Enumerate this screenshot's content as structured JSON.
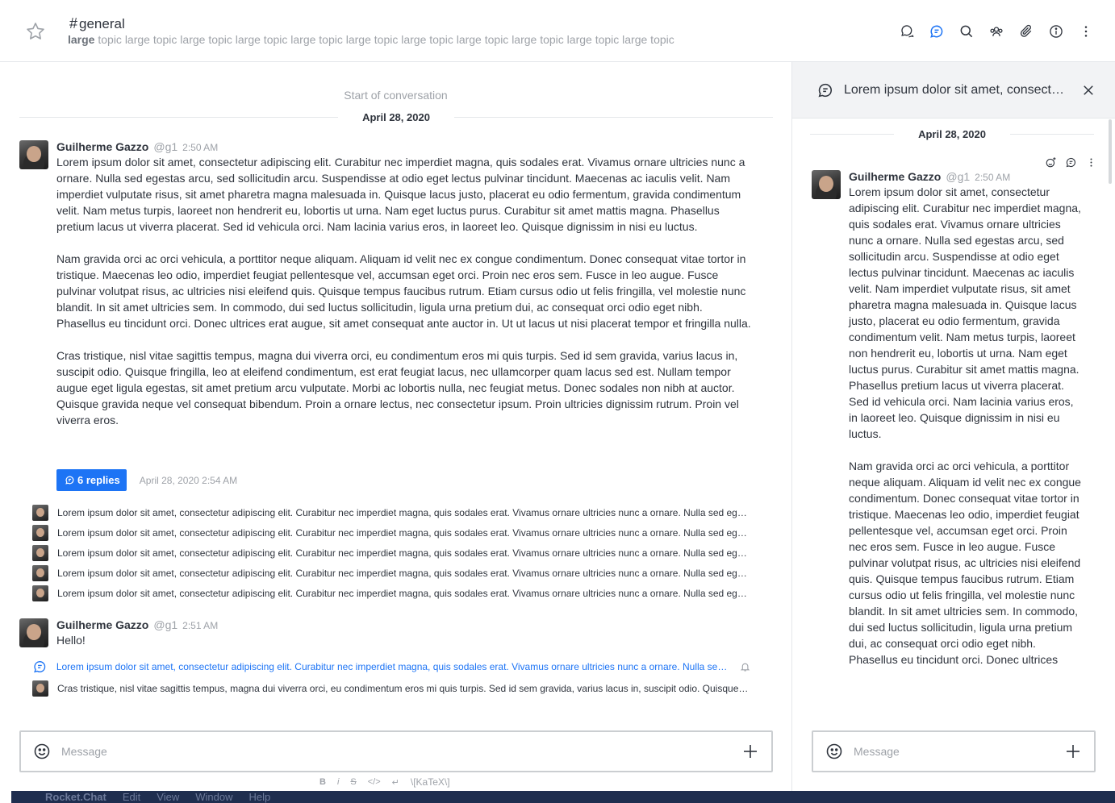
{
  "header": {
    "channel_hash": "#",
    "channel_name": "general",
    "topic_bold": "large",
    "topic_rest": " topic large topic large topic large topic large topic large topic large topic large topic large topic large topic large topic"
  },
  "main": {
    "start_of_conversation": "Start of conversation",
    "date_divider": "April 28, 2020",
    "message1": {
      "name": "Guilherme Gazzo",
      "username": "@g1",
      "time": "2:50 AM",
      "paragraphs": [
        "Lorem ipsum dolor sit amet, consectetur adipiscing elit. Curabitur nec imperdiet magna, quis sodales erat. Vivamus ornare ultricies nunc a ornare. Nulla sed egestas arcu, sed sollicitudin arcu. Suspendisse at odio eget lectus pulvinar tincidunt. Maecenas ac iaculis velit. Nam imperdiet vulputate risus, sit amet pharetra magna malesuada in. Quisque lacus justo, placerat eu odio fermentum, gravida condimentum velit. Nam metus turpis, laoreet non hendrerit eu, lobortis ut urna. Nam eget luctus purus. Curabitur sit amet mattis magna. Phasellus pretium lacus ut viverra placerat. Sed id vehicula orci. Nam lacinia varius eros, in laoreet leo. Quisque dignissim in nisi eu luctus.",
        "Nam gravida orci ac orci vehicula, a porttitor neque aliquam. Aliquam id velit nec ex congue condimentum. Donec consequat vitae tortor in tristique. Maecenas leo odio, imperdiet feugiat pellentesque vel, accumsan eget orci. Proin nec eros sem. Fusce in leo augue. Fusce pulvinar volutpat risus, ac ultricies nisi eleifend quis. Quisque tempus faucibus rutrum. Etiam cursus odio ut felis fringilla, vel molestie nunc blandit. In sit amet ultricies sem. In commodo, dui sed luctus sollicitudin, ligula urna pretium dui, ac consequat orci odio eget nibh. Phasellus eu tincidunt orci. Donec ultrices erat augue, sit amet consequat ante auctor in. Ut ut lacus ut nisi placerat tempor et fringilla nulla.",
        "Cras tristique, nisl vitae sagittis tempus, magna dui viverra orci, eu condimentum eros mi quis turpis. Sed id sem gravida, varius lacus in, suscipit odio. Quisque fringilla, leo at eleifend condimentum, est erat feugiat lacus, nec ullamcorper quam lacus sed est. Nullam tempor augue eget ligula egestas, sit amet pretium arcu vulputate. Morbi ac lobortis nulla, nec feugiat metus. Donec sodales non nibh at auctor. Quisque gravida neque vel consequat bibendum. Proin a ornare lectus, nec consectetur ipsum. Proin ultricies dignissim rutrum. Proin vel viverra eros."
      ],
      "replies_label": "6 replies",
      "replies_date": "April 28, 2020 2:54 AM"
    },
    "thread_replies": [
      "Lorem ipsum dolor sit amet, consectetur adipiscing elit. Curabitur nec imperdiet magna, quis sodales erat. Vivamus ornare ultricies nunc a ornare. Nulla sed egestas arcu",
      "Lorem ipsum dolor sit amet, consectetur adipiscing elit. Curabitur nec imperdiet magna, quis sodales erat. Vivamus ornare ultricies nunc a ornare. Nulla sed egestas arcu",
      "Lorem ipsum dolor sit amet, consectetur adipiscing elit. Curabitur nec imperdiet magna, quis sodales erat. Vivamus ornare ultricies nunc a ornare. Nulla sed egestas arcu",
      "Lorem ipsum dolor sit amet, consectetur adipiscing elit. Curabitur nec imperdiet magna, quis sodales erat. Vivamus ornare ultricies nunc a ornare. Nulla sed egestas arcu",
      "Lorem ipsum dolor sit amet, consectetur adipiscing elit. Curabitur nec imperdiet magna, quis sodales erat. Vivamus ornare ultricies nunc a ornare. Nulla sed egestas arcu"
    ],
    "message2": {
      "name": "Guilherme Gazzo",
      "username": "@g1",
      "time": "2:51 AM",
      "text": "Hello!"
    },
    "thread_link_text": "Lorem ipsum dolor sit amet, consectetur adipiscing elit. Curabitur nec imperdiet magna, quis sodales erat. Vivamus ornare ultricies nunc a ornare. Nulla sed egestas arcu",
    "thread_reply_last": "Cras tristique, nisl vitae sagittis tempus, magna dui viverra orci, eu condimentum eros mi quis turpis. Sed id sem gravida, varius lacus in, suscipit odio. Quisque fringilla",
    "composer_placeholder": "Message",
    "format_bar": [
      "B",
      "i",
      "S",
      "</>",
      "↵",
      "\\[KaTeX\\]"
    ]
  },
  "panel": {
    "title": "Lorem ipsum dolor sit amet, consectetur adipiscing elit. Curabitur nec imperdiet magna",
    "date_divider": "April 28, 2020",
    "message": {
      "name": "Guilherme Gazzo",
      "username": "@g1",
      "time": "2:50 AM",
      "paragraphs": [
        "Lorem ipsum dolor sit amet, consectetur adipiscing elit. Curabitur nec imperdiet magna, quis sodales erat. Vivamus ornare ultricies nunc a ornare. Nulla sed egestas arcu, sed sollicitudin arcu. Suspendisse at odio eget lectus pulvinar tincidunt. Maecenas ac iaculis velit. Nam imperdiet vulputate risus, sit amet pharetra magna malesuada in. Quisque lacus justo, placerat eu odio fermentum, gravida condimentum velit. Nam metus turpis, laoreet non hendrerit eu, lobortis ut urna. Nam eget luctus purus. Curabitur sit amet mattis magna. Phasellus pretium lacus ut viverra placerat. Sed id vehicula orci. Nam lacinia varius eros, in laoreet leo. Quisque dignissim in nisi eu luctus.",
        "Nam gravida orci ac orci vehicula, a porttitor neque aliquam. Aliquam id velit nec ex congue condimentum. Donec consequat vitae tortor in tristique. Maecenas leo odio, imperdiet feugiat pellentesque vel, accumsan eget orci. Proin nec eros sem. Fusce in leo augue. Fusce pulvinar volutpat risus, ac ultricies nisi eleifend quis. Quisque tempus faucibus rutrum. Etiam cursus odio ut felis fringilla, vel molestie nunc blandit. In sit amet ultricies sem. In commodo, dui sed luctus sollicitudin, ligula urna pretium dui, ac consequat orci odio eget nibh. Phasellus eu tincidunt orci. Donec ultrices"
      ]
    },
    "composer_placeholder": "Message"
  },
  "menubar": {
    "apple": "",
    "items": [
      "Rocket.Chat",
      "Edit",
      "View",
      "Window",
      "Help"
    ]
  },
  "colors": {
    "accent": "#1d74f5",
    "muted": "#9ea2a8",
    "text": "#2f343d"
  }
}
